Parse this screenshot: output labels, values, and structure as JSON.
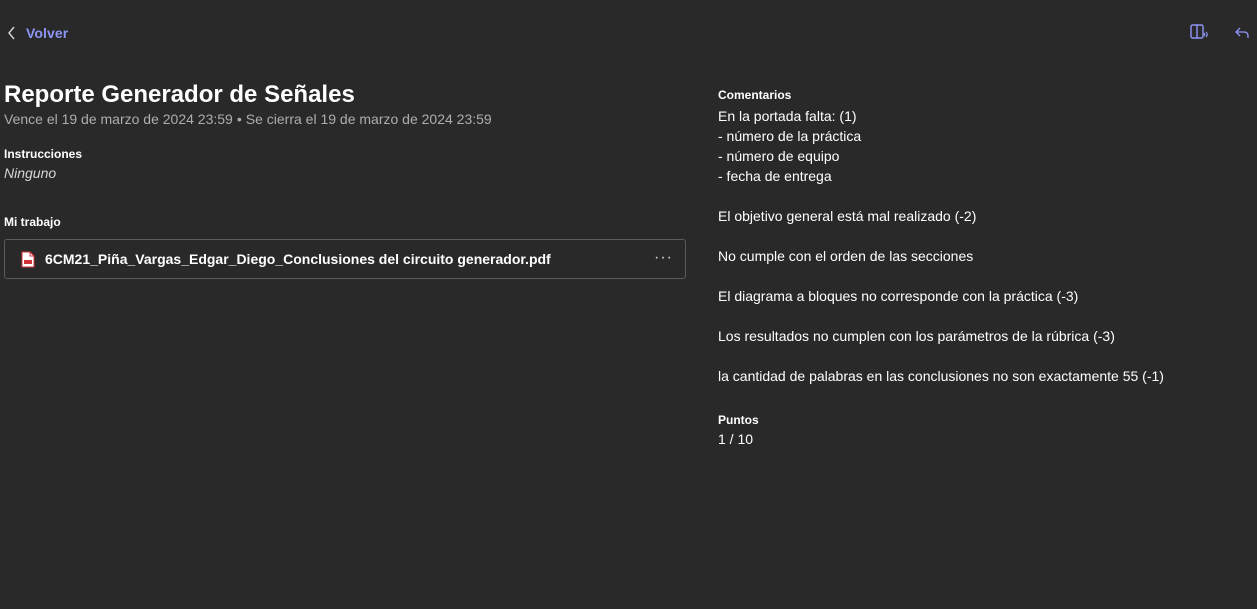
{
  "header": {
    "back_label": "Volver",
    "icons": [
      "chevron-left-icon",
      "immersive-reader-icon",
      "reply-icon"
    ],
    "accent_color": "#8f95f5"
  },
  "assignment": {
    "title": "Reporte Generador de Señales",
    "due": "Vence el 19 de marzo de 2024 23:59",
    "separator": "•",
    "closes": "Se cierra el 19 de marzo de 2024 23:59",
    "instructions_label": "Instrucciones",
    "instructions_value": "Ninguno",
    "my_work_label": "Mi trabajo",
    "file": {
      "name": "6CM21_Piña_Vargas_Edgar_Diego_Conclusiones del circuito generador.pdf",
      "icon": "pdf-file-icon",
      "more_label": "···"
    }
  },
  "feedback": {
    "comments_label": "Comentarios",
    "comments_text": "En la portada falta: (1)\n- número de la práctica\n- número de equipo\n- fecha de entrega\n\nEl objetivo general está mal realizado (-2)\n\nNo cumple con el orden de las secciones\n\nEl diagrama a bloques no corresponde con la práctica (-3)\n\nLos resultados no cumplen con los parámetros de la rúbrica (-3)\n\nla cantidad de palabras en las conclusiones no son exactamente 55 (-1)",
    "points_label": "Puntos",
    "points_value": "1 / 10"
  }
}
